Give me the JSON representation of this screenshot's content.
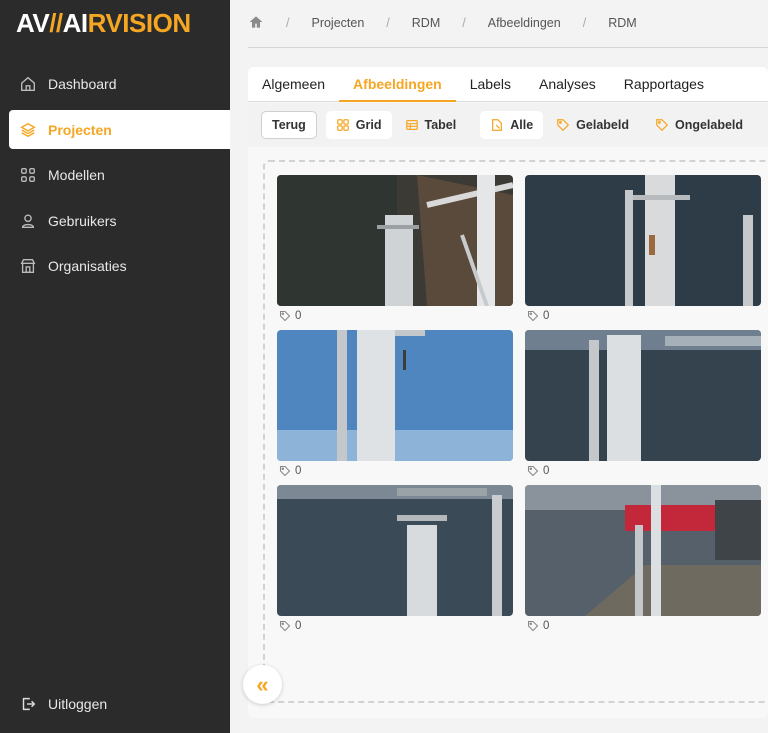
{
  "logo": {
    "part1": "AV",
    "part2": "//",
    "part3": "AI",
    "part4": "RVISION"
  },
  "sidebar": {
    "items": [
      {
        "label": "Dashboard",
        "icon": "home-icon"
      },
      {
        "label": "Projecten",
        "icon": "layers-icon",
        "active": true
      },
      {
        "label": "Modellen",
        "icon": "grid-icon"
      },
      {
        "label": "Gebruikers",
        "icon": "user-icon"
      },
      {
        "label": "Organisaties",
        "icon": "building-icon"
      }
    ],
    "logout": "Uitloggen"
  },
  "breadcrumb": [
    "Projecten",
    "RDM",
    "Afbeeldingen",
    "RDM"
  ],
  "tabs": [
    "Algemeen",
    "Afbeeldingen",
    "Labels",
    "Analyses",
    "Rapportages"
  ],
  "active_tab": "Afbeeldingen",
  "toolbar": {
    "back": "Terug",
    "grid": "Grid",
    "table": "Tabel",
    "all": "Alle",
    "labeled": "Gelabeld",
    "unlabeled": "Ongelabeld"
  },
  "images": [
    {
      "tag_count": "0"
    },
    {
      "tag_count": "0"
    },
    {
      "tag_count": "0"
    },
    {
      "tag_count": "0"
    },
    {
      "tag_count": "0"
    },
    {
      "tag_count": "0"
    }
  ],
  "colors": {
    "accent": "#f5a623",
    "sidebar": "#2b2b2b"
  }
}
